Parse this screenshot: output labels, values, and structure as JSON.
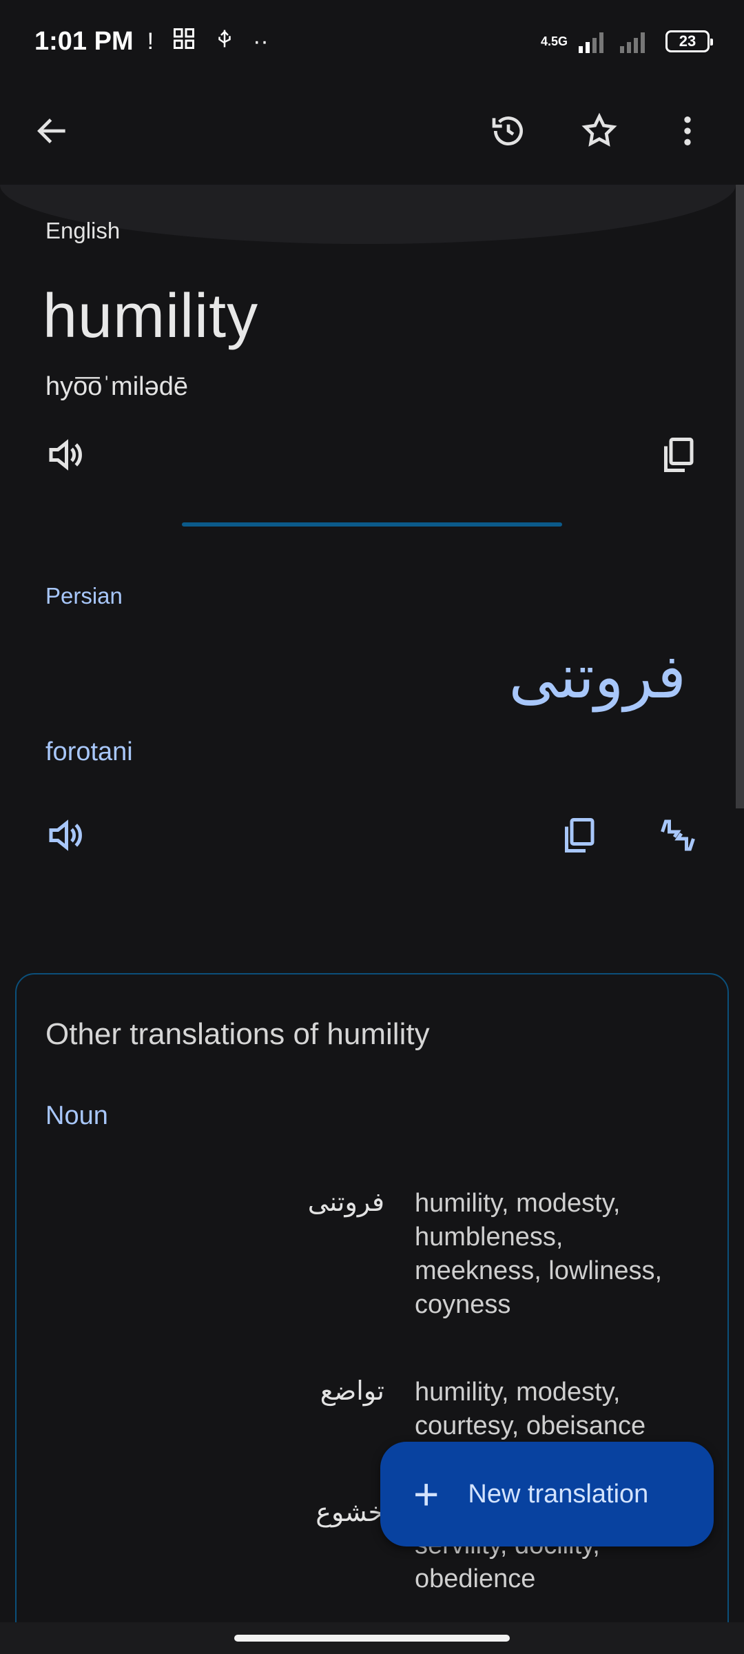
{
  "status_bar": {
    "time": "1:01 PM",
    "network_label": "4.5G",
    "battery": "23"
  },
  "toolbar": {
    "back_icon": "arrow-back-icon",
    "history_icon": "history-icon",
    "favorite_icon": "star-icon",
    "more_icon": "more-vert-icon"
  },
  "source": {
    "language": "English",
    "word": "humility",
    "phonetic": "hyo͞oˈmilədē"
  },
  "target": {
    "language": "Persian",
    "word": "فروتنی",
    "transliteration": "forotani"
  },
  "other_translations": {
    "title": "Other translations of humility",
    "part_of_speech": "Noun",
    "rows": [
      {
        "fa": "فروتنی",
        "en": "humility, modesty, humbleness, meekness, lowliness, coyness"
      },
      {
        "fa": "تواضع",
        "en": "humility, modesty, courtesy, obeisance"
      },
      {
        "fa": "خشوع",
        "en": "servility, docility, obedience"
      }
    ]
  },
  "fab": {
    "label": "New translation"
  },
  "colors": {
    "background": "#141416",
    "accent": "#a8c7fa",
    "fab": "#0842a0",
    "divider": "#0b5a8a"
  }
}
